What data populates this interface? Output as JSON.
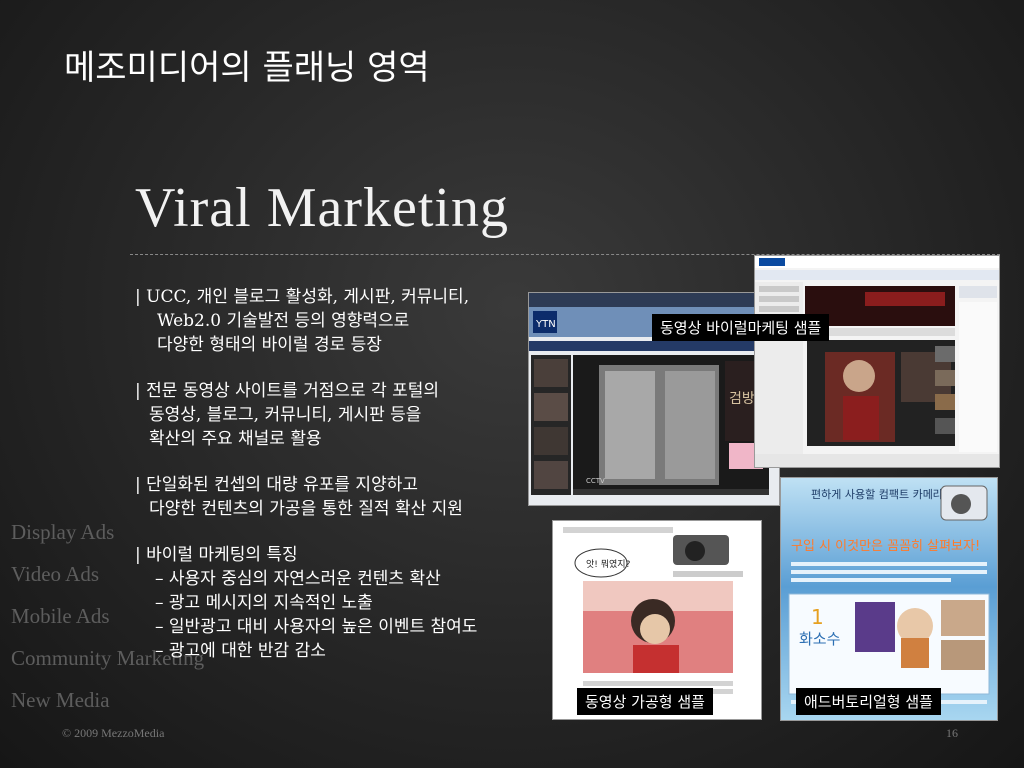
{
  "page_title": "메조미디어의 플래닝 영역",
  "main_heading": "Viral Marketing",
  "side_menu": [
    "Display Ads",
    "Video Ads",
    "Mobile Ads",
    "Community Marketing",
    "New Media"
  ],
  "bullets": {
    "b1_line1": "| UCC, 개인 블로그 활성화, 게시판, 커뮤니티,",
    "b1_line2": "Web2.0 기술발전 등의 영향력으로",
    "b1_line3": "다양한 형태의 바이럴 경로 등장",
    "b2_line1": "| 전문 동영상 사이트를 거점으로 각 포털의",
    "b2_line2": "동영상, 블로그, 커뮤니티, 게시판 등을",
    "b2_line3": "확산의 주요 채널로 활용",
    "b3_line1": "| 단일화된 컨셉의 대량 유포를 지양하고",
    "b3_line2": "다양한 컨텐츠의 가공을 통한 질적 확산 지원",
    "b4_line1": "| 바이럴 마케팅의 특징",
    "b4_sub1": "– 사용자 중심의 자연스러운 컨텐츠 확산",
    "b4_sub2": "– 광고 메시지의 지속적인 노출",
    "b4_sub3": "– 일반광고 대비 사용자의 높은 이벤트 참여도",
    "b4_sub4": "– 광고에 대한 반감 감소"
  },
  "images": {
    "video_label": "동영상 바이럴마케팅 샘플",
    "processed_label": "동영상 가공형 샘플",
    "advertorial_label": "애드버토리얼형 샘플",
    "ytn_logo": "YTN",
    "cctv_text": "CCTV",
    "advertorial_title": "편하게 사용할 컴팩트 카메라",
    "advertorial_headline": "구입 시 이것만은 꼼꼼히 살펴보자!",
    "advertorial_name": "화소수",
    "processed_bubble": "앗! 뭐였지?"
  },
  "footer": {
    "copyright": "© 2009 MezzoMedia",
    "page_number": "16"
  }
}
